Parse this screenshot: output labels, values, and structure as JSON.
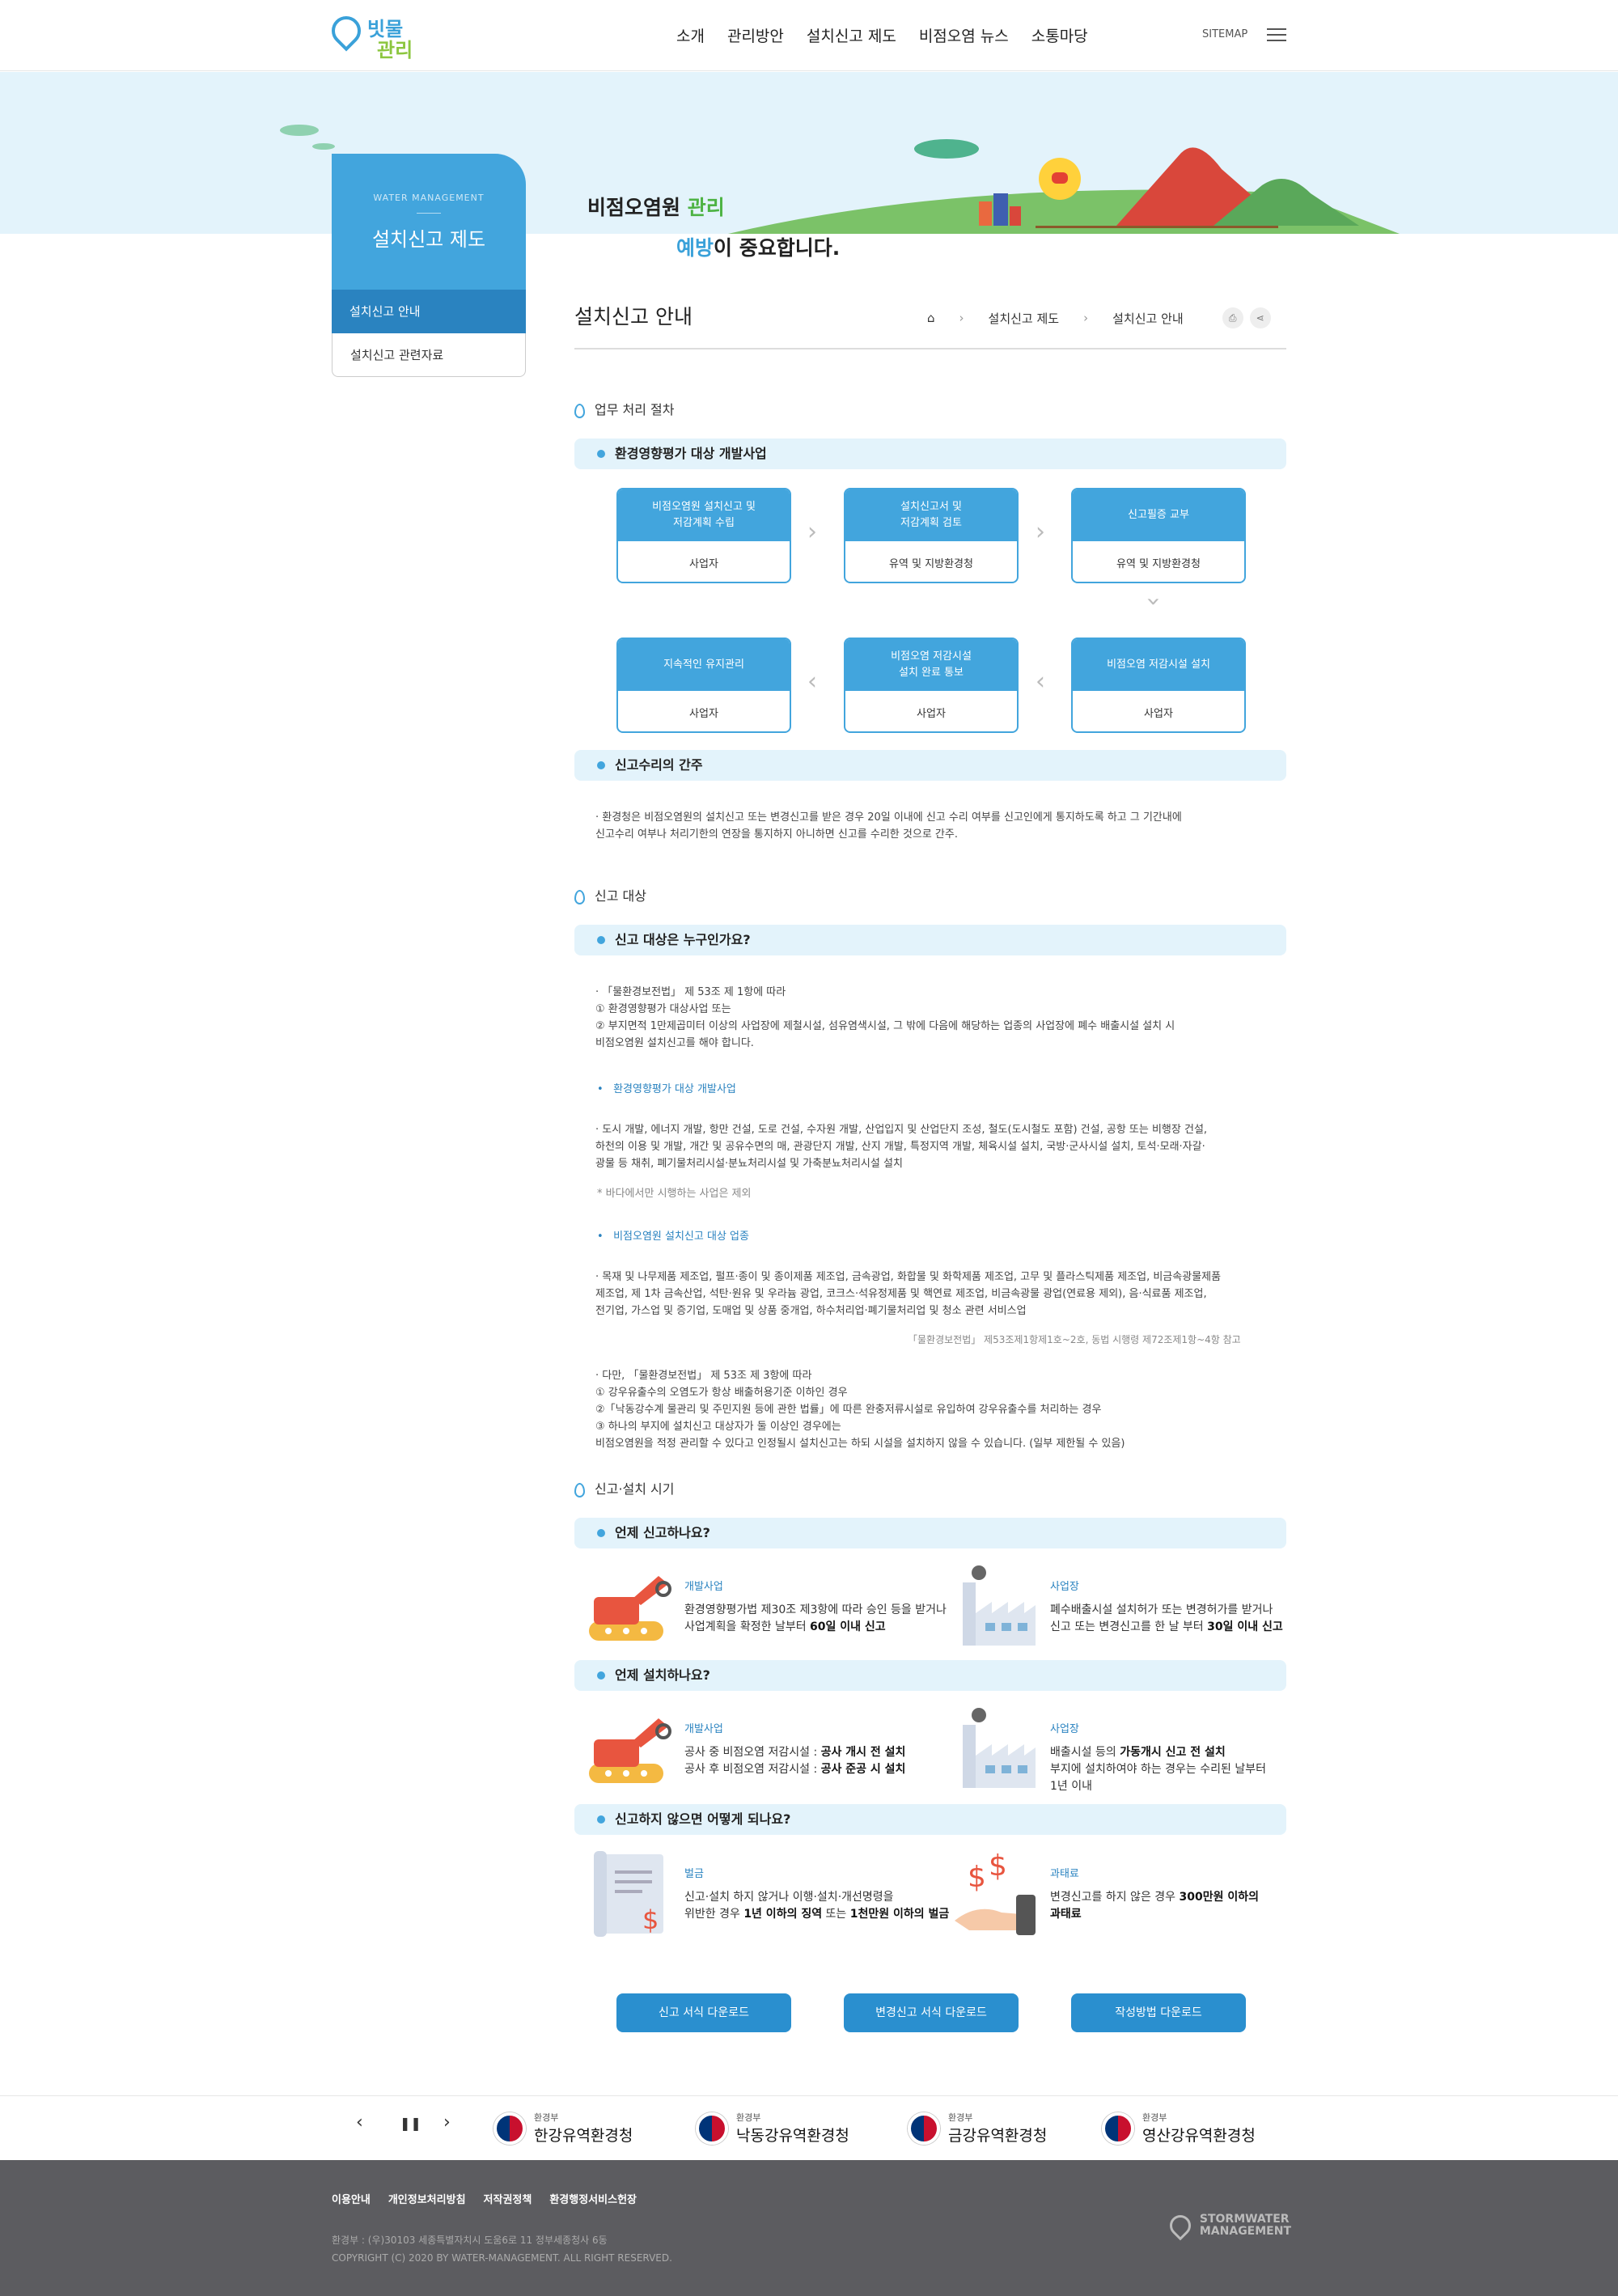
{
  "header": {
    "logo": {
      "line1": "빗물",
      "line2": "관리"
    },
    "nav": [
      "소개",
      "관리방안",
      "설치신고 제도",
      "비점오염 뉴스",
      "소통마당"
    ],
    "sitemap": "SITEMAP",
    "menu_icon": "hamburger-icon"
  },
  "banner": {
    "line1_pre": "비점오염원 ",
    "line1_hl": "관리",
    "line2_hl": "예방",
    "line2_post": "이 중요합니다."
  },
  "sidebar": {
    "en": "WATER MANAGEMENT",
    "title": "설치신고 제도",
    "items": [
      "설치신고 안내",
      "설치신고 관련자료"
    ]
  },
  "page": {
    "title": "설치신고 안내",
    "breadcrumb": [
      "설치신고 제도",
      "설치신고 안내"
    ],
    "icons": [
      "home-icon",
      "print-icon",
      "share-icon"
    ]
  },
  "section1": {
    "title": "업무 처리 절차",
    "bar1": "환경영향평가 대상 개발사업",
    "flow": [
      {
        "top": "비점오염원 설치신고 및\n저감계획 수립",
        "bottom": "사업자"
      },
      {
        "top": "설치신고서 및\n저감계획 검토",
        "bottom": "유역 및 지방환경청"
      },
      {
        "top": "신고필증 교부",
        "bottom": "유역 및 지방환경청"
      },
      {
        "top": "비점오염 저감시설 설치",
        "bottom": "사업자"
      },
      {
        "top": "비점오염 저감시설\n설치 완료 통보",
        "bottom": "사업자"
      },
      {
        "top": "지속적인 유지관리",
        "bottom": "사업자"
      }
    ],
    "bar2": "신고수리의 간주",
    "text": "· 환경청은 비점오염원의 설치신고 또는 변경신고를 받은 경우 20일 이내에 신고 수리 여부를 신고인에게 통지하도록 하고 그 기간내에\n   신고수리 여부나 처리기한의 연장을 통지하지 아니하면 신고를 수리한 것으로 간주."
  },
  "section2": {
    "title": "신고 대상",
    "bar": "신고 대상은 누구인가요?",
    "p1": "· 「물환경보전법」 제 53조 제 1항에 따라\n   ① 환경영향평가 대상사업 또는\n   ② 부지면적 1만제곱미터 이상의 사업장에 제철시설, 섬유염색시설, 그 밖에 다음에 해당하는 업종의 사업장에 폐수 배출시설 설치 시\n   비점오염원 설치신고를 해야 합니다.",
    "sub1": "환경영향평가 대상 개발사업",
    "p2": "· 도시 개발, 에너지 개발, 항만 건설, 도로 건설, 수자원 개발, 산업입지 및 산업단지 조성, 철도(도시철도 포함) 건설, 공항 또는 비행장 건설,\n   하천의 이용 및 개발, 개간 및 공유수면의 매, 관광단지 개발, 산지 개발, 특정지역 개발, 체육시설 설치, 국방·군사시설 설치, 토석·모래·자갈·\n   광물 등 채취, 폐기물처리시설·분뇨처리시설 및 가축분뇨처리시설 설치",
    "note": "* 바다에서만 시행하는 사업은 제외",
    "sub2": "비점오염원 설치신고 대상 업종",
    "p3": "· 목재 및 나무제품 제조업, 펄프·종이 및 종이제품 제조업, 금속광업, 화합물 및 화학제품 제조업, 고무 및 플라스틱제품 제조업, 비금속광물제품\n   제조업, 제 1차 금속산업, 석탄·원유 및 우라늄 광업, 코크스·석유정제품 및 핵연료 제조업, 비금속광물 광업(연료용 제외), 음·식료품 제조업,\n   전기업, 가스업 및 증기업, 도매업 및 상품 중개업, 하수처리업·폐기물처리업 및 청소 관련 서비스업",
    "ref": "「물환경보전법」 제53조제1항제1호~2호, 동법 시행령 제72조제1항~4항 참고",
    "p4": "· 다만, 「물환경보전법」 제 53조 제 3항에 따라\n   ① 강우유출수의 오염도가 항상 배출허용기준 이하인 경우\n   ②「낙동강수계 물관리 및 주민지원 등에 관한 법률」에 따른 완충저류시설로 유입하여 강우유출수를 처리하는 경우\n   ③ 하나의 부지에 설치신고 대상자가 둘 이상인 경우에는\n   비점오염원을 적정 관리할 수 있다고 인정될시 설치신고는 하되 시설을 설치하지 않을 수 있습니다. (일부 제한될 수 있음)"
  },
  "section3": {
    "title": "신고·설치 시기",
    "bar1": "언제 신고하나요?",
    "when_report": [
      {
        "label": "개발사업",
        "text": "환경영향평가법 제30조 제3항에 따라 승인 등을 받거나\n사업계획을 확정한 날부터 ",
        "bold": "60일 이내 신고",
        "icon": "excavator-icon"
      },
      {
        "label": "사업장",
        "text": "폐수배출시설 설치허가 또는 변경허가를 받거나\n신고 또는 변경신고를 한 날 부터 ",
        "bold": "30일 이내 신고",
        "icon": "factory-icon"
      }
    ],
    "bar2": "언제 설치하나요?",
    "when_install": [
      {
        "label": "개발사업",
        "lines": [
          "공사 중 비점오염 저감시설 : ",
          "공사 개시 전 설치",
          "공사 후 비점오염 저감시설 : ",
          "공사 준공 시 설치"
        ],
        "icon": "excavator-icon"
      },
      {
        "label": "사업장",
        "lines": [
          "배출시설 등의 ",
          "가동개시 신고 전 설치",
          "부지에 설치하여야 하는 경우는 수리된 날부터",
          "1년 이내"
        ],
        "icon": "factory-icon"
      }
    ],
    "bar3": "신고하지 않으면 어떻게 되나요?",
    "penalty": [
      {
        "label": "벌금",
        "pre": "신고·설치 하지 않거나 이행·설치·개선명령을\n위반한 경우 ",
        "b1": "1년 이하의 징역",
        "mid": " 또는 ",
        "b2": "1천만원 이하의 벌금",
        "icon": "document-dollar-icon"
      },
      {
        "label": "과태료",
        "pre": "변경신고를 하지 않은 경우 ",
        "b1": "300만원 이하의",
        "b2": "과태료",
        "icon": "hand-dollar-icon"
      }
    ]
  },
  "downloads": [
    "신고 서식 다운로드",
    "변경신고 서식 다운로드",
    "작성방법 다운로드"
  ],
  "partners": {
    "controls": [
      "‹",
      "❚❚",
      "›"
    ],
    "ministry": "환경부",
    "names": [
      "한강유역환경청",
      "낙동강유역환경청",
      "금강유역환경청",
      "영산강유역환경청"
    ]
  },
  "footer": {
    "links": [
      "이용안내",
      "개인정보처리방침",
      "저작권정책",
      "환경행정서비스헌장"
    ],
    "address": "환경부 : (우)30103 세종특별자치시 도움6로 11 정부세종청사 6동",
    "copyright": "COPYRIGHT (C) 2020 BY WATER-MANAGEMENT. ALL RIGHT RESERVED.",
    "logo": {
      "line1": "STORMWATER",
      "line2": "MANAGEMENT"
    }
  },
  "colors": {
    "primary": "#42a5dd",
    "dark_primary": "#2a83c0",
    "light_bg": "#e3f3fb",
    "green": "#4db343",
    "footer_bg": "#5c5c60"
  }
}
